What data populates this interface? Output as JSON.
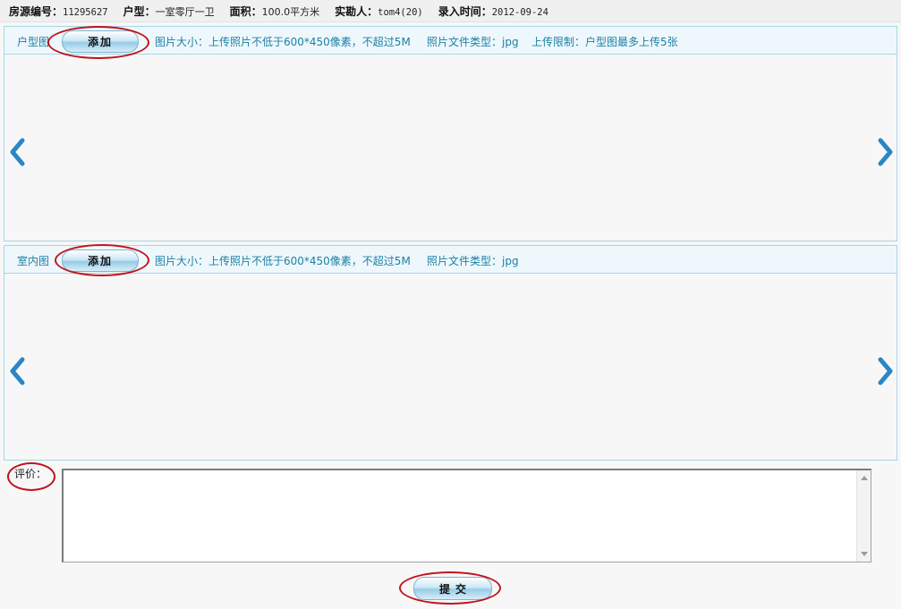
{
  "info": {
    "listing_no_label": "房源编号：",
    "listing_no": "11295627",
    "layout_label": "户型：",
    "layout": "一室零厅一卫",
    "area_label": "面积：",
    "area": "100.0平方米",
    "surveyor_label": "实勘人：",
    "surveyor": "tom4(20)",
    "entry_time_label": "录入时间：",
    "entry_time": "2012-09-24"
  },
  "floorplan": {
    "title": "户型图",
    "add_label": "添加",
    "size_note": "图片大小：上传照片不低于600*450像素，不超过5M",
    "type_note": "照片文件类型：jpg",
    "limit_note": "上传限制：户型图最多上传5张"
  },
  "interior": {
    "title": "室内图",
    "add_label": "添加",
    "size_note": "图片大小：上传照片不低于600*450像素，不超过5M",
    "type_note": "照片文件类型：jpg"
  },
  "comment": {
    "label": "评价：",
    "value": ""
  },
  "submit_label": "提交",
  "icons": {
    "prev": "chevron-left-icon",
    "next": "chevron-right-icon"
  },
  "colors": {
    "accent_text": "#1d7fa6",
    "panel_border": "#a9d5e3",
    "highlight_ring": "#c0141b",
    "arrow": "#2b86c5"
  }
}
